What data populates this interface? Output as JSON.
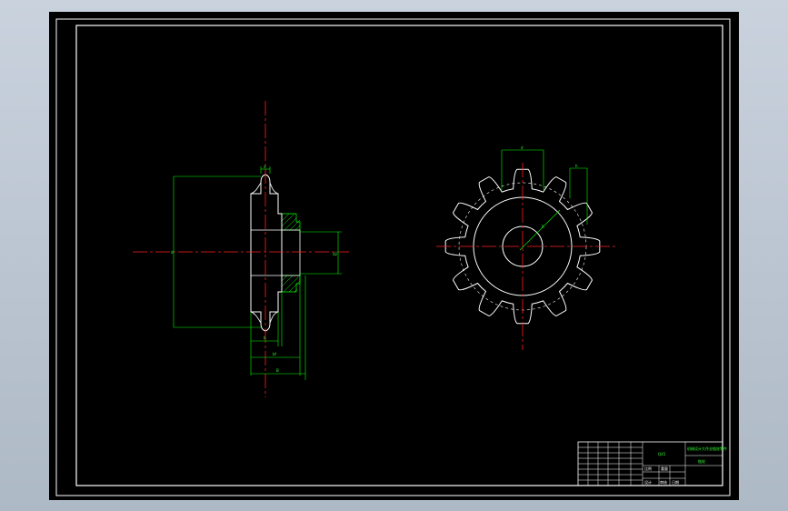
{
  "colors": {
    "viewport_background": "#000000",
    "frame": "#ffffff",
    "outline": "#ffffff",
    "dimension": "#00ff00",
    "centerline": "#ff2020",
    "hatch": "#00ff00",
    "title_text": "#33ff33"
  },
  "side_view": {
    "dim_pitch_top": "d",
    "dim_outer": "d",
    "dim_hub": "d2",
    "dim_bottom_1": "b",
    "dim_bottom_2": "bf",
    "dim_bottom_3": "B"
  },
  "front_view": {
    "dim_top": "d",
    "dim_right": "h",
    "radius_label": "R"
  },
  "title_block": {
    "material": "Q45",
    "title": "机械设计大作业链轮零件",
    "name": "链轮",
    "scale_header": "比例",
    "weight_header": "重量",
    "sign_row": [
      "设计",
      "审核",
      "日期"
    ]
  }
}
